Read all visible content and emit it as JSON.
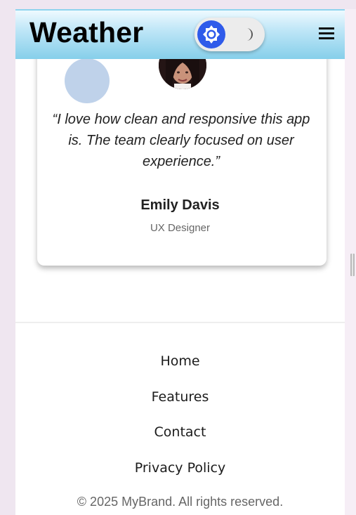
{
  "header": {
    "app_title": "Weather",
    "theme_toggle": {
      "active": "light",
      "icons": [
        "sun-icon",
        "moon-icon"
      ],
      "accent": "#2f5bea"
    },
    "menu_icon": "hamburger-menu-icon"
  },
  "testimonial": {
    "quote": "“I love how clean and responsive this app is. The team clearly focused on user experience.”",
    "author": "Emily Davis",
    "role": "UX Designer"
  },
  "footer": {
    "links": [
      "Home",
      "Features",
      "Contact",
      "Privacy Policy"
    ],
    "copyright": "© 2025 MyBrand. All rights reserved."
  }
}
